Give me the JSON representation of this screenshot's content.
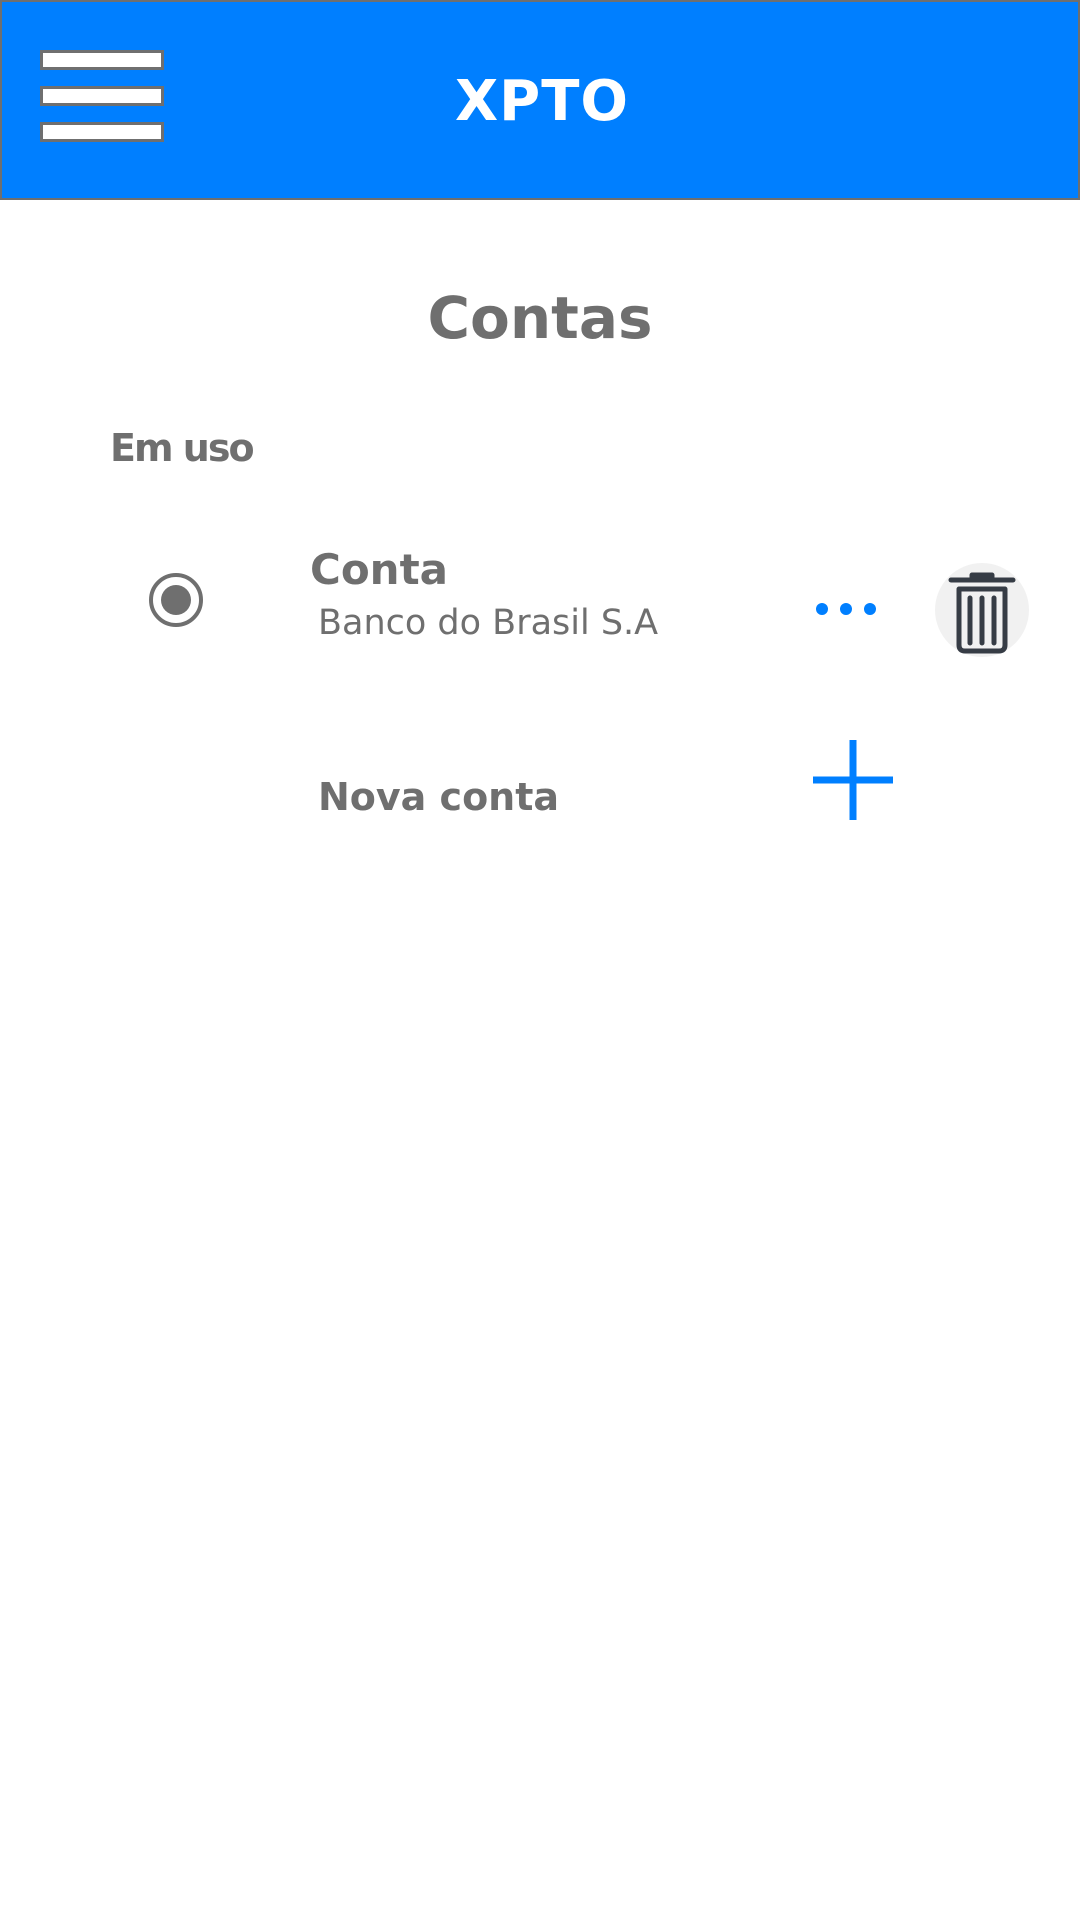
{
  "app_bar": {
    "title": "XPTO",
    "menu_icon": "hamburger-menu-icon",
    "color": "#007fff"
  },
  "page": {
    "title": "Contas"
  },
  "accounts_section": {
    "label": "Em uso",
    "items": [
      {
        "name": "Conta",
        "bank": "Banco do Brasil S.A",
        "selected": true,
        "radio_icon": "radio-selected-icon",
        "more_icon": "more-horizontal-icon",
        "delete_icon": "trash-icon"
      }
    ]
  },
  "new_account": {
    "label": "Nova conta",
    "icon": "plus-icon"
  },
  "colors": {
    "accent": "#007fff",
    "text": "#6f6f6f",
    "background": "#ffffff"
  }
}
